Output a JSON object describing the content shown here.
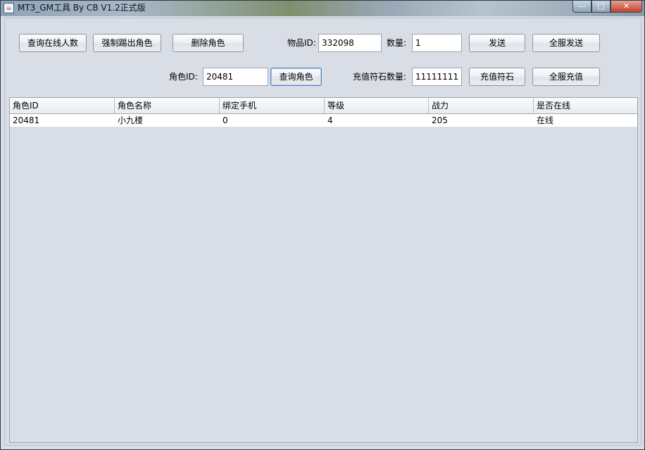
{
  "window": {
    "title": "MT3_GM工具 By CB V1.2正式版",
    "app_icon": "java-cup-icon"
  },
  "toolbar": {
    "query_online": "查询在线人数",
    "force_kick": "强制踢出角色",
    "delete_role": "删除角色",
    "item_id_label": "物品ID:",
    "item_id_value": "332098",
    "quantity_label": "数量:",
    "quantity_value": "1",
    "send": "发送",
    "send_all": "全服发送",
    "role_id_label": "角色ID:",
    "role_id_value": "20481",
    "query_role": "查询角色",
    "recharge_qty_label": "充值符石数量:",
    "recharge_qty_value": "11111111",
    "recharge": "充值符石",
    "recharge_all": "全服充值"
  },
  "table": {
    "columns": [
      "角色ID",
      "角色名称",
      "绑定手机",
      "等级",
      "战力",
      "是否在线"
    ],
    "rows": [
      [
        "20481",
        "小九楼",
        "0",
        "4",
        "205",
        "在线"
      ]
    ]
  }
}
